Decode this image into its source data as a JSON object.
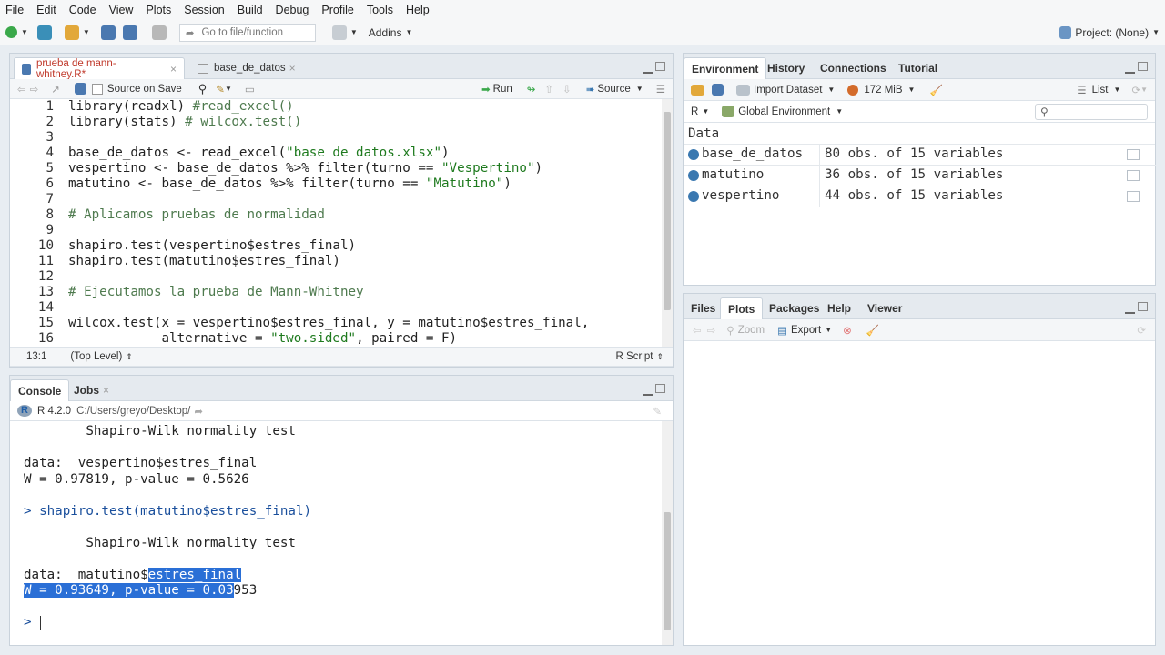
{
  "menu": [
    "File",
    "Edit",
    "Code",
    "View",
    "Plots",
    "Session",
    "Build",
    "Debug",
    "Profile",
    "Tools",
    "Help"
  ],
  "toolbar": {
    "goto_placeholder": "Go to file/function",
    "addins": "Addins",
    "project": "Project: (None)"
  },
  "editor": {
    "tabs": [
      {
        "label": "prueba de mann-whitney.R*"
      },
      {
        "label": "base_de_datos"
      }
    ],
    "source_on_save": "Source on Save",
    "run": "Run",
    "source": "Source",
    "lines": [
      {
        "n": "1",
        "parts": [
          {
            "t": "library(readxl) ",
            "c": "fn"
          },
          {
            "t": "#read_excel()",
            "c": "cm"
          }
        ]
      },
      {
        "n": "2",
        "parts": [
          {
            "t": "library(stats) ",
            "c": "fn"
          },
          {
            "t": "# wilcox.test()",
            "c": "cm"
          }
        ]
      },
      {
        "n": "3",
        "parts": []
      },
      {
        "n": "4",
        "parts": [
          {
            "t": "base_de_datos <- read_excel(",
            "c": "fn"
          },
          {
            "t": "\"base de datos.xlsx\"",
            "c": "st"
          },
          {
            "t": ")",
            "c": "fn"
          }
        ]
      },
      {
        "n": "5",
        "parts": [
          {
            "t": "vespertino <- base_de_datos %>% filter(turno == ",
            "c": "fn"
          },
          {
            "t": "\"Vespertino\"",
            "c": "st"
          },
          {
            "t": ")",
            "c": "fn"
          }
        ]
      },
      {
        "n": "6",
        "parts": [
          {
            "t": "matutino <- base_de_datos %>% filter(turno == ",
            "c": "fn"
          },
          {
            "t": "\"Matutino\"",
            "c": "st"
          },
          {
            "t": ")",
            "c": "fn"
          }
        ]
      },
      {
        "n": "7",
        "parts": []
      },
      {
        "n": "8",
        "parts": [
          {
            "t": "# Aplicamos pruebas de normalidad",
            "c": "cm"
          }
        ]
      },
      {
        "n": "9",
        "parts": []
      },
      {
        "n": "10",
        "parts": [
          {
            "t": "shapiro.test(vespertino$estres_final)",
            "c": "fn"
          }
        ]
      },
      {
        "n": "11",
        "parts": [
          {
            "t": "shapiro.test(matutino$estres_final)",
            "c": "fn"
          }
        ]
      },
      {
        "n": "12",
        "parts": []
      },
      {
        "n": "13",
        "parts": [
          {
            "t": "# Ejecutamos la prueba de Mann-Whitney",
            "c": "cm"
          }
        ]
      },
      {
        "n": "14",
        "parts": []
      },
      {
        "n": "15",
        "parts": [
          {
            "t": "wilcox.test(x = vespertino$estres_final, y = matutino$estres_final,",
            "c": "fn"
          }
        ]
      },
      {
        "n": "16",
        "parts": [
          {
            "t": "            alternative = ",
            "c": "fn"
          },
          {
            "t": "\"two.sided\"",
            "c": "st"
          },
          {
            "t": ", paired = F)",
            "c": "fn"
          }
        ]
      }
    ],
    "status_pos": "13:1",
    "status_scope": "(Top Level)",
    "status_type": "R Script"
  },
  "console": {
    "tabs": [
      "Console",
      "Jobs"
    ],
    "version": "R 4.2.0",
    "path": "C:/Users/greyo/Desktop/",
    "lines": [
      {
        "t": "        Shapiro-Wilk normality test",
        "c": ""
      },
      {
        "t": "",
        "c": ""
      },
      {
        "t": "data:  vespertino$estres_final",
        "c": ""
      },
      {
        "t": "W = 0.97819, p-value = 0.5626",
        "c": ""
      },
      {
        "t": "",
        "c": ""
      },
      {
        "t": "> shapiro.test(matutino$estres_final)",
        "c": "cmd"
      },
      {
        "t": "",
        "c": ""
      },
      {
        "t": "        Shapiro-Wilk normality test",
        "c": ""
      },
      {
        "t": "",
        "c": ""
      }
    ],
    "sel_line1_pre": "data:  matutino$",
    "sel_line1_sel": "estres_final",
    "sel_line2_sel": "W = 0.93649, p-value = 0.03",
    "sel_line2_post": "953",
    "prompt": ">"
  },
  "env": {
    "tabs": [
      "Environment",
      "History",
      "Connections",
      "Tutorial"
    ],
    "import": "Import Dataset",
    "memory": "172 MiB",
    "list": "List",
    "lang": "R",
    "scope": "Global Environment",
    "section": "Data",
    "rows": [
      {
        "name": "base_de_datos",
        "desc": "80 obs. of 15 variables"
      },
      {
        "name": "matutino",
        "desc": "36 obs. of 15 variables"
      },
      {
        "name": "vespertino",
        "desc": "44 obs. of 15 variables"
      }
    ]
  },
  "files": {
    "tabs": [
      "Files",
      "Plots",
      "Packages",
      "Help",
      "Viewer"
    ],
    "zoom": "Zoom",
    "export": "Export"
  },
  "colors": {
    "accent": "#2a6fd6",
    "comment": "#4e7a4e",
    "string": "#1e7a1e"
  }
}
